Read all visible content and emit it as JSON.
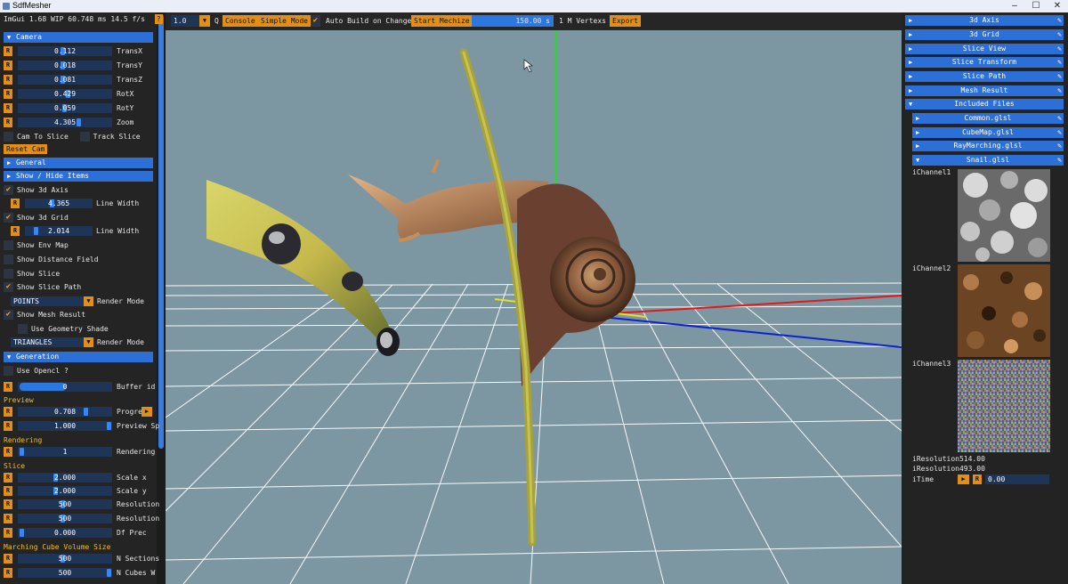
{
  "window": {
    "title": "SdfMesher"
  },
  "status": {
    "text": "ImGui 1.68 WIP 60.748 ms 14.5 f/s",
    "help": "?"
  },
  "left": {
    "camera": {
      "header": "Camera",
      "rows": [
        {
          "value": "0.112",
          "label": "TransX"
        },
        {
          "value": "0.018",
          "label": "TransY"
        },
        {
          "value": "0.081",
          "label": "TransZ"
        },
        {
          "value": "0.429",
          "label": "RotX"
        },
        {
          "value": "0.059",
          "label": "RotY"
        },
        {
          "value": "4.305",
          "label": "Zoom"
        }
      ],
      "cam_to_slice": "Cam To Slice",
      "track_slice": "Track Slice",
      "reset_cam": "Reset Cam"
    },
    "general_header": "General",
    "show_hide": {
      "header": "Show / Hide Items",
      "show_3d_axis": "Show 3d Axis",
      "axis_width": "4.365",
      "line_width": "Line Width",
      "show_3d_grid": "Show 3d Grid",
      "grid_width": "2.014",
      "show_env_map": "Show Env Map",
      "show_distance_field": "Show Distance Field",
      "show_slice": "Show Slice",
      "show_slice_path": "Show Slice Path",
      "points": "POINTS",
      "render_mode": "Render Mode",
      "show_mesh_result": "Show Mesh Result",
      "use_geometry_shade": "Use Geometry Shade",
      "triangles": "TRIANGLES"
    },
    "generation": {
      "header": "Generation",
      "use_opencl": "Use Opencl ?",
      "buffer_value": "0",
      "buffer_label": "Buffer id"
    },
    "preview": {
      "title": "Preview",
      "progress_value": "0.708",
      "progress_label": "Progre",
      "preview_value": "1.000",
      "preview_label": "Preview Sp"
    },
    "rendering": {
      "title": "Rendering",
      "value": "1",
      "label": "Rendering"
    },
    "slice": {
      "title": "Slice",
      "rows": [
        {
          "value": "2.000",
          "label": "Scale x"
        },
        {
          "value": "2.000",
          "label": "Scale y"
        },
        {
          "value": "500",
          "label": "Resolution"
        },
        {
          "value": "500",
          "label": "Resolution"
        },
        {
          "value": "0.000",
          "label": "Df Prec"
        }
      ]
    },
    "marching": {
      "title": "Marching Cube Volume Size",
      "rows": [
        {
          "value": "500",
          "label": "N Sections"
        },
        {
          "value": "500",
          "label": "N Cubes W"
        }
      ]
    },
    "r": "R"
  },
  "toolbar": {
    "scale": "1.0",
    "q": "Q",
    "console": "Console",
    "simple_mode": "Simple Mode",
    "auto_build": "Auto Build on Changes",
    "start": "Start Mechize",
    "progress": "150.00 s",
    "vertex": "1 M Vertexs",
    "export": "Export"
  },
  "right": {
    "items": [
      "3d Axis",
      "3d Grid",
      "Slice View",
      "Slice Transform",
      "Slice Path",
      "Mesh Result",
      "Included Files"
    ],
    "files": [
      "Common.glsl",
      "CubeMap.glsl",
      "RayMarching.glsl",
      "Snail.glsl"
    ],
    "channels": [
      "iChannel1",
      "iChannel2",
      "iChannel3"
    ],
    "res1_label": "iResolution",
    "res1_value": "514.00",
    "res2_label": "iResolution",
    "res2_value": "493.00",
    "itime_label": "iTime",
    "itime_value": "0.00"
  },
  "colors": {
    "accent": "#2c6fd6",
    "button": "#e0901a",
    "viewport": "#7c96a2"
  }
}
